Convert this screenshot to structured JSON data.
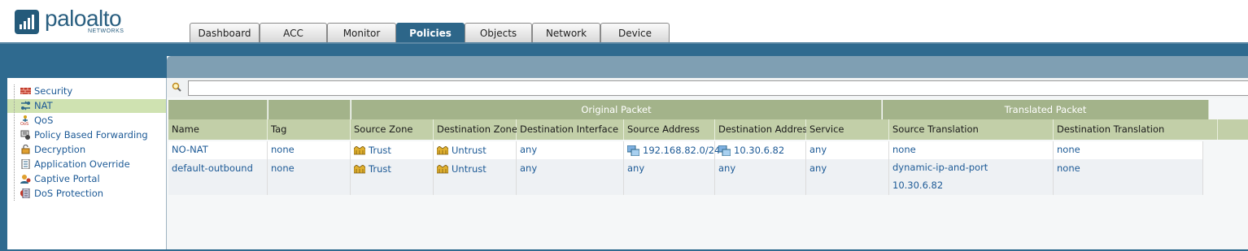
{
  "brand": {
    "name": "paloalto",
    "sub": "NETWORKS"
  },
  "tabs": [
    "Dashboard",
    "ACC",
    "Monitor",
    "Policies",
    "Objects",
    "Network",
    "Device"
  ],
  "active_tab": "Policies",
  "sidebar": {
    "items": [
      {
        "label": "Security",
        "icon": "security-icon"
      },
      {
        "label": "NAT",
        "icon": "nat-icon",
        "active": true
      },
      {
        "label": "QoS",
        "icon": "qos-icon"
      },
      {
        "label": "Policy Based Forwarding",
        "icon": "pbf-icon"
      },
      {
        "label": "Decryption",
        "icon": "decryption-icon"
      },
      {
        "label": "Application Override",
        "icon": "app-override-icon"
      },
      {
        "label": "Captive Portal",
        "icon": "captive-portal-icon"
      },
      {
        "label": "DoS Protection",
        "icon": "dos-protection-icon"
      }
    ]
  },
  "search": {
    "value": "",
    "placeholder": ""
  },
  "table": {
    "groups": [
      "Original Packet",
      "Translated Packet"
    ],
    "columns": [
      "Name",
      "Tag",
      "Source Zone",
      "Destination Zone",
      "Destination Interface",
      "Source Address",
      "Destination Address",
      "Service",
      "Source Translation",
      "Destination Translation"
    ],
    "rows": [
      {
        "name": "NO-NAT",
        "tag": "none",
        "source_zone": "Trust",
        "destination_zone": "Untrust",
        "destination_interface": "any",
        "source_address": "192.168.82.0/24",
        "destination_address": "10.30.6.82",
        "service": "any",
        "source_translation": "none",
        "source_translation_2": "",
        "destination_translation": "none"
      },
      {
        "name": "default-outbound",
        "tag": "none",
        "source_zone": "Trust",
        "destination_zone": "Untrust",
        "destination_interface": "any",
        "source_address": "any",
        "destination_address": "any",
        "service": "any",
        "source_translation": "dynamic-ip-and-port",
        "source_translation_2": "10.30.6.82",
        "destination_translation": "none"
      }
    ]
  },
  "colors": {
    "brand_blue": "#2f6a8f",
    "tab_active": "#2d6689",
    "header_green": "#c2cfa8",
    "group_green": "#a3b38a",
    "link": "#1d5a96"
  }
}
